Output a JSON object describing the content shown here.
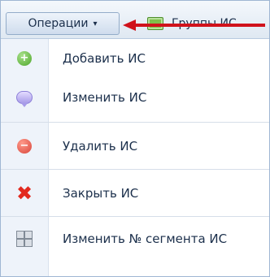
{
  "toolbar": {
    "operations_label": "Операции",
    "operations_caret": "▾",
    "groups_label": "Группы ИС"
  },
  "menu": {
    "items": [
      {
        "label": "Добавить ИС",
        "icon": "add-circle-icon"
      },
      {
        "label": "Изменить ИС",
        "icon": "edit-speech-bubble-icon"
      },
      {
        "label": "Удалить ИС",
        "icon": "remove-circle-icon"
      },
      {
        "label": "Закрыть ИС",
        "icon": "close-x-icon"
      },
      {
        "label": "Изменить № сегмента ИС",
        "icon": "segments-icon"
      }
    ]
  },
  "colors": {
    "accent_arrow": "#d0121b",
    "menu_text": "#1b2f4b",
    "gutter_bg": "#eef3fa",
    "toolbar_border": "#9fb6d3"
  }
}
